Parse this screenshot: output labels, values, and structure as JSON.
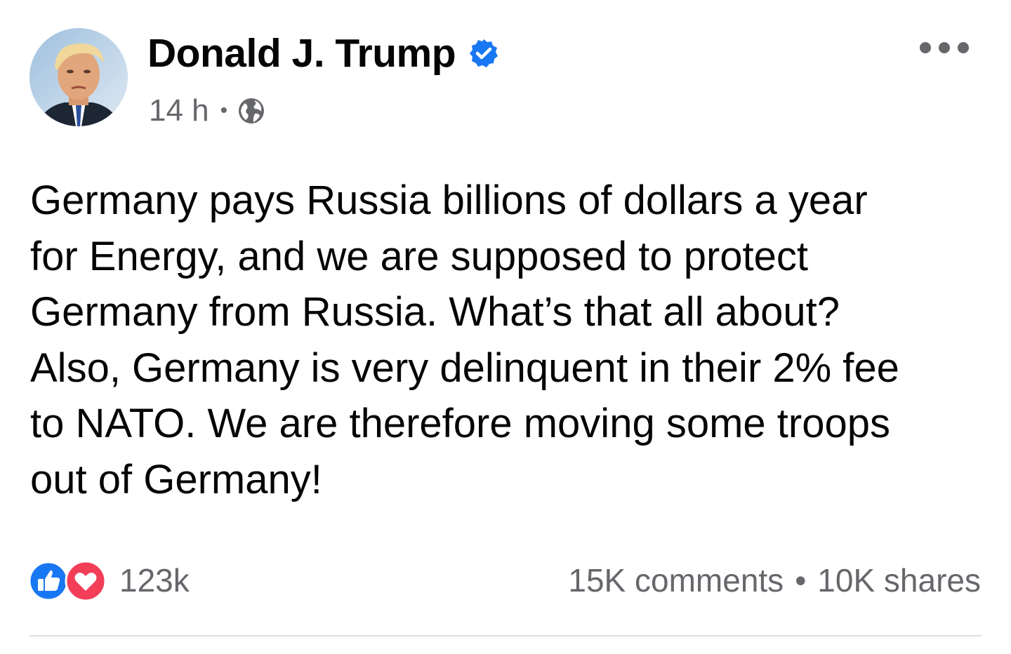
{
  "post": {
    "author": {
      "name": "Donald J. Trump",
      "verified": true
    },
    "timestamp": "14 h",
    "separator": "•",
    "privacy_icon": "globe-icon",
    "more_icon": "more-options-icon",
    "text": "Germany pays Russia billions of dollars a year\nfor Energy, and we are supposed to protect\nGermany from Russia. What’s that all about?\nAlso, Germany is very delinquent in their 2% fee\nto NATO. We are therefore moving some troops\nout of Germany!",
    "reactions": {
      "icons": [
        "like-icon",
        "love-icon"
      ],
      "count": "123k"
    },
    "comments": "15K comments",
    "dot": "•",
    "shares": "10K shares"
  },
  "colors": {
    "text": "#050505",
    "secondary_text": "#65676b",
    "verified_blue": "#1877f2",
    "like_blue": "#1877f2",
    "love_red": "#f33e58",
    "divider": "#dadde1"
  }
}
